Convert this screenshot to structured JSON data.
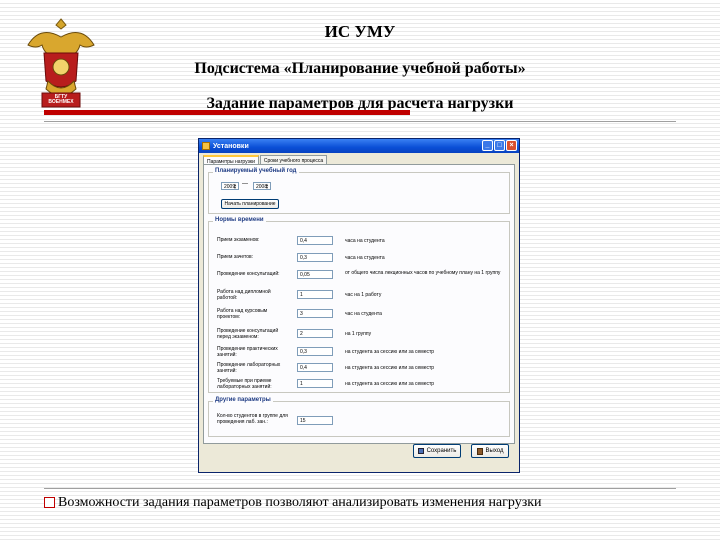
{
  "slide": {
    "title_line1": "ИС УМУ",
    "title_line2": "Подсистема «Планирование учебной работы»",
    "title_line3": "Задание параметров для расчета нагрузки",
    "caption": "Возможности задания параметров позволяют анализировать изменения нагрузки",
    "logo_text": "БГТУ ВОЕНМЕХ"
  },
  "colors": {
    "accent_red": "#c00000",
    "titlebar_blue": "#0a4fd6"
  },
  "window": {
    "title": "Установки",
    "tabs": [
      {
        "label": "Параметры нагрузки",
        "active": true
      },
      {
        "label": "Сроки учебного процесса",
        "active": false
      }
    ],
    "year_group": {
      "label": "Планируемый учебный год",
      "from": "2009",
      "to": "2008",
      "separator": "—",
      "start_button": "Начать планирование"
    },
    "norms_group": {
      "label": "Нормы времени",
      "rows": [
        {
          "label": "Прием экзаменов:",
          "value": "0,4",
          "unit": "часа на студента"
        },
        {
          "label": "Прием зачетов:",
          "value": "0,3",
          "unit": "часа на студента"
        },
        {
          "label": "Проведение консультаций:",
          "value": "0,05",
          "unit": "от общего числа лекционных часов по учебному плану на 1 группу"
        },
        {
          "label": "Работа над дипломной работой:",
          "value": "1",
          "unit": "час на 1 работу"
        },
        {
          "label": "Работа над курсовым проектом:",
          "value": "3",
          "unit": "час на студента"
        },
        {
          "label": "Проведение консультаций перед экзаменом:",
          "value": "2",
          "unit": "на 1 группу"
        },
        {
          "label": "Проведение практических занятий:",
          "value": "0,3",
          "unit": "на студента за сессию или за семестр"
        },
        {
          "label": "Проведение лабораторных занятий:",
          "value": "0,4",
          "unit": "на студента за сессию или за семестр"
        },
        {
          "label": "Требуемые при приеме лабораторных занятий:",
          "value": "1",
          "unit": "на студента за сессию или за семестр"
        }
      ]
    },
    "other_group": {
      "label": "Другие параметры",
      "rows": [
        {
          "label": "Кол-во студентов в группе для проведения лаб. зан.:",
          "value": "15"
        }
      ]
    },
    "buttons": {
      "save": "Сохранить",
      "exit": "Выход"
    }
  }
}
